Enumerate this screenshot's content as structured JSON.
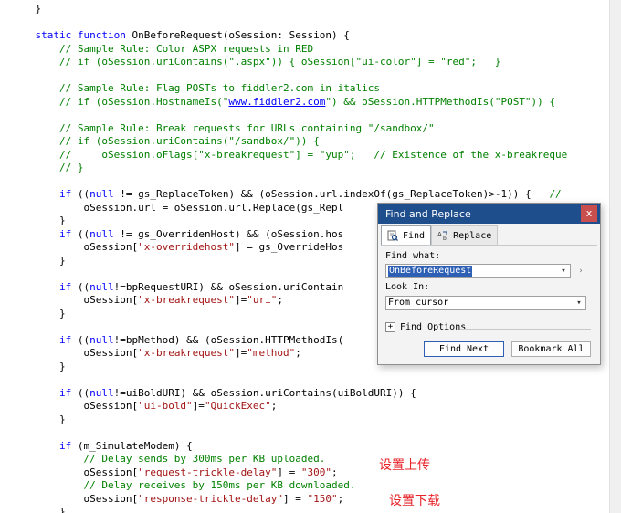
{
  "editor": {
    "lines": [
      [
        {
          "t": "    }",
          "c": "tx"
        }
      ],
      [
        {
          "t": "",
          "c": "tx"
        }
      ],
      [
        {
          "t": "    static function ",
          "c": "kw"
        },
        {
          "t": "OnBeforeRequest(oSession: Session) {",
          "c": "tx"
        }
      ],
      [
        {
          "t": "        // Sample Rule: Color ASPX requests in RED",
          "c": "cm"
        }
      ],
      [
        {
          "t": "        // if (oSession.uriContains(\".aspx\")) { oSession[\"ui-color\"] = \"red\";   }",
          "c": "cm"
        }
      ],
      [
        {
          "t": "",
          "c": "tx"
        }
      ],
      [
        {
          "t": "        // Sample Rule: Flag POSTs to fiddler2.com in italics",
          "c": "cm"
        }
      ],
      [
        {
          "t": "        // if (oSession.HostnameIs(\"",
          "c": "cm"
        },
        {
          "t": "www.fiddler2.com",
          "c": "ln"
        },
        {
          "t": "\") && oSession.HTTPMethodIs(\"POST\")) {",
          "c": "cm"
        }
      ],
      [
        {
          "t": "",
          "c": "tx"
        }
      ],
      [
        {
          "t": "        // Sample Rule: Break requests for URLs containing \"/sandbox/\"",
          "c": "cm"
        }
      ],
      [
        {
          "t": "        // if (oSession.uriContains(\"/sandbox/\")) {",
          "c": "cm"
        }
      ],
      [
        {
          "t": "        //     oSession.oFlags[\"x-breakrequest\"] = \"yup\";   // Existence of the x-breakreque",
          "c": "cm"
        }
      ],
      [
        {
          "t": "        // }",
          "c": "cm"
        }
      ],
      [
        {
          "t": "",
          "c": "tx"
        }
      ],
      [
        {
          "t": "        if ",
          "c": "kw"
        },
        {
          "t": "((",
          "c": "tx"
        },
        {
          "t": "null",
          "c": "kw"
        },
        {
          "t": " != gs_ReplaceToken) && (oSession.url.indexOf(gs_ReplaceToken)>-1)) {   ",
          "c": "tx"
        },
        {
          "t": "//",
          "c": "cm"
        }
      ],
      [
        {
          "t": "            oSession.url = oSession.url.Replace(gs_Repl",
          "c": "tx"
        }
      ],
      [
        {
          "t": "        }",
          "c": "tx"
        }
      ],
      [
        {
          "t": "        if ",
          "c": "kw"
        },
        {
          "t": "((",
          "c": "tx"
        },
        {
          "t": "null",
          "c": "kw"
        },
        {
          "t": " != gs_OverridenHost) && (oSession.hos",
          "c": "tx"
        }
      ],
      [
        {
          "t": "            oSession[",
          "c": "tx"
        },
        {
          "t": "\"x-overridehost\"",
          "c": "st"
        },
        {
          "t": "] = gs_OverrideHos",
          "c": "tx"
        }
      ],
      [
        {
          "t": "        }",
          "c": "tx"
        }
      ],
      [
        {
          "t": "",
          "c": "tx"
        }
      ],
      [
        {
          "t": "        if ",
          "c": "kw"
        },
        {
          "t": "((",
          "c": "tx"
        },
        {
          "t": "null",
          "c": "kw"
        },
        {
          "t": "!=bpRequestURI) && oSession.uriContain",
          "c": "tx"
        }
      ],
      [
        {
          "t": "            oSession[",
          "c": "tx"
        },
        {
          "t": "\"x-breakrequest\"",
          "c": "st"
        },
        {
          "t": "]=",
          "c": "tx"
        },
        {
          "t": "\"uri\"",
          "c": "st"
        },
        {
          "t": ";",
          "c": "tx"
        }
      ],
      [
        {
          "t": "        }",
          "c": "tx"
        }
      ],
      [
        {
          "t": "",
          "c": "tx"
        }
      ],
      [
        {
          "t": "        if ",
          "c": "kw"
        },
        {
          "t": "((",
          "c": "tx"
        },
        {
          "t": "null",
          "c": "kw"
        },
        {
          "t": "!=bpMethod) && (oSession.HTTPMethodIs(",
          "c": "tx"
        }
      ],
      [
        {
          "t": "            oSession[",
          "c": "tx"
        },
        {
          "t": "\"x-breakrequest\"",
          "c": "st"
        },
        {
          "t": "]=",
          "c": "tx"
        },
        {
          "t": "\"method\"",
          "c": "st"
        },
        {
          "t": ";",
          "c": "tx"
        }
      ],
      [
        {
          "t": "        }",
          "c": "tx"
        }
      ],
      [
        {
          "t": "",
          "c": "tx"
        }
      ],
      [
        {
          "t": "        if ",
          "c": "kw"
        },
        {
          "t": "((",
          "c": "tx"
        },
        {
          "t": "null",
          "c": "kw"
        },
        {
          "t": "!=uiBoldURI) && oSession.uriContains(uiBoldURI)) {",
          "c": "tx"
        }
      ],
      [
        {
          "t": "            oSession[",
          "c": "tx"
        },
        {
          "t": "\"ui-bold\"",
          "c": "st"
        },
        {
          "t": "]=",
          "c": "tx"
        },
        {
          "t": "\"QuickExec\"",
          "c": "st"
        },
        {
          "t": ";",
          "c": "tx"
        }
      ],
      [
        {
          "t": "        }",
          "c": "tx"
        }
      ],
      [
        {
          "t": "",
          "c": "tx"
        }
      ],
      [
        {
          "t": "        if ",
          "c": "kw"
        },
        {
          "t": "(m_SimulateModem) {",
          "c": "tx"
        }
      ],
      [
        {
          "t": "            // Delay sends by 300ms per KB uploaded.",
          "c": "cm"
        }
      ],
      [
        {
          "t": "            oSession[",
          "c": "tx"
        },
        {
          "t": "\"request-trickle-delay\"",
          "c": "st"
        },
        {
          "t": "] = ",
          "c": "tx"
        },
        {
          "t": "\"300\"",
          "c": "st"
        },
        {
          "t": ";",
          "c": "tx"
        }
      ],
      [
        {
          "t": "            // Delay receives by 150ms per KB downloaded.",
          "c": "cm"
        }
      ],
      [
        {
          "t": "            oSession[",
          "c": "tx"
        },
        {
          "t": "\"response-trickle-delay\"",
          "c": "st"
        },
        {
          "t": "] = ",
          "c": "tx"
        },
        {
          "t": "\"150\"",
          "c": "st"
        },
        {
          "t": ";",
          "c": "tx"
        }
      ],
      [
        {
          "t": "        }",
          "c": "tx"
        }
      ]
    ]
  },
  "annotations": {
    "upload": "设置上传",
    "download": "设置下载"
  },
  "colors": {
    "keyword": "#0000ff",
    "comment": "#008000",
    "string": "#a31515",
    "annotation": "#e8232a",
    "dialog_title_bg": "#1f4e8c",
    "selection": "#2d5fb5"
  },
  "dialog": {
    "title": "Find and Replace",
    "close_glyph": "x",
    "tabs": [
      {
        "label": "Find",
        "icon": "find-icon",
        "active": true
      },
      {
        "label": "Replace",
        "icon": "replace-icon",
        "active": false
      }
    ],
    "find_what_label": "Find what:",
    "find_what_value": "OnBeforeRequest",
    "look_in_label": "Look In:",
    "look_in_value": "From cursor",
    "find_options_label": "Find Options",
    "find_next_label": "Find Next",
    "bookmark_all_label": "Bookmark All"
  }
}
